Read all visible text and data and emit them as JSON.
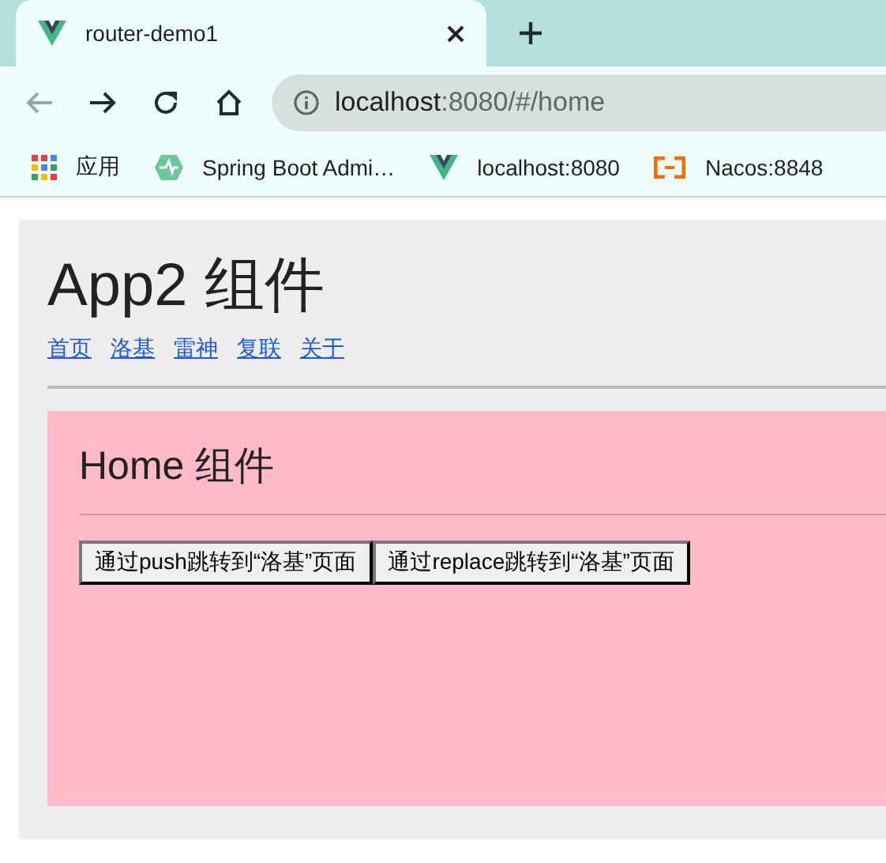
{
  "tabs": [
    {
      "title": "router-demo1",
      "selected": true
    }
  ],
  "toolbar": {
    "buttons": [
      {
        "kind": "back",
        "disabled": true
      },
      {
        "kind": "forward",
        "disabled": false
      },
      {
        "kind": "reload",
        "disabled": false
      },
      {
        "kind": "home",
        "disabled": false
      }
    ],
    "address": {
      "host": "localhost",
      "rest": ":8080/#/home"
    }
  },
  "bookmarks": [
    {
      "kind": "apps",
      "label": "应用"
    },
    {
      "kind": "pulse",
      "label": "Spring Boot Admi…"
    },
    {
      "kind": "vue",
      "label": "localhost:8080"
    },
    {
      "kind": "bracket",
      "label": "Nacos:8848"
    }
  ],
  "page": {
    "title": "App2 组件",
    "nav_links": [
      "首页",
      "洛基",
      "雷神",
      "复联",
      "关于"
    ],
    "content": {
      "heading": "Home 组件",
      "buttons": [
        "通过push跳转到“洛基”页面",
        "通过replace跳转到“洛基”页面"
      ]
    }
  }
}
